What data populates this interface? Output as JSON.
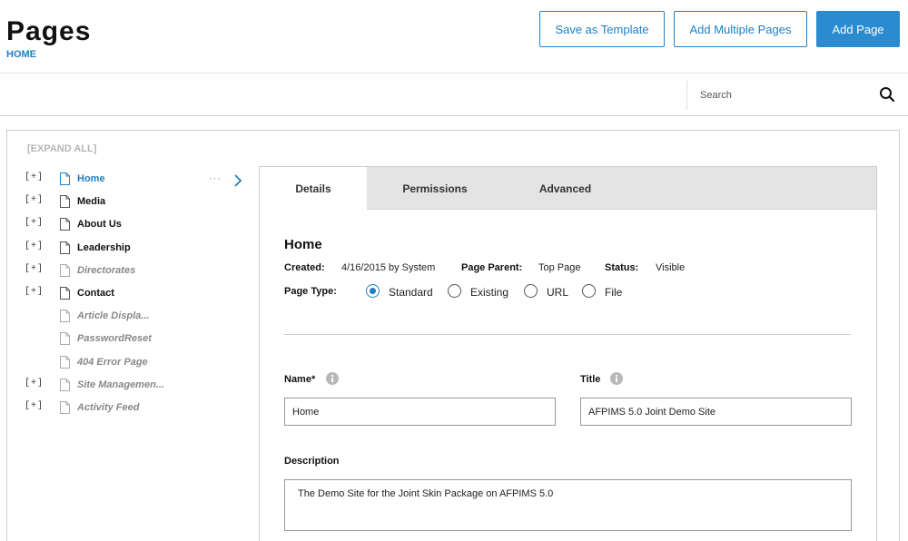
{
  "header": {
    "title": "Pages",
    "breadcrumb": "HOME",
    "buttons": {
      "save_template": "Save as Template",
      "add_multiple": "Add Multiple Pages",
      "add_page": "Add Page"
    }
  },
  "search": {
    "placeholder": "Search",
    "icon": "search-icon"
  },
  "tree": {
    "expand_all": "[EXPAND ALL]",
    "items": [
      {
        "label": "Home",
        "toggle": "[+]",
        "style": "active"
      },
      {
        "label": "Media",
        "toggle": "[+]",
        "style": "normal"
      },
      {
        "label": "About Us",
        "toggle": "[+]",
        "style": "normal"
      },
      {
        "label": "Leadership",
        "toggle": "[+]",
        "style": "normal"
      },
      {
        "label": "Directorates",
        "toggle": "[+]",
        "style": "italic"
      },
      {
        "label": "Contact",
        "toggle": "[+]",
        "style": "normal"
      },
      {
        "label": "Article Displa...",
        "toggle": "",
        "style": "italic"
      },
      {
        "label": "PasswordReset",
        "toggle": "",
        "style": "italic"
      },
      {
        "label": "404 Error Page",
        "toggle": "",
        "style": "italic"
      },
      {
        "label": "Site Managemen...",
        "toggle": "[+]",
        "style": "italic"
      },
      {
        "label": "Activity Feed",
        "toggle": "[+]",
        "style": "italic"
      }
    ],
    "active_dots": "···"
  },
  "tabs": [
    "Details",
    "Permissions",
    "Advanced"
  ],
  "details": {
    "title": "Home",
    "created_label": "Created:",
    "created_value": "4/16/2015 by System",
    "parent_label": "Page Parent:",
    "parent_value": "Top Page",
    "status_label": "Status:",
    "status_value": "Visible",
    "page_type_label": "Page Type:",
    "page_types": [
      "Standard",
      "Existing",
      "URL",
      "File"
    ],
    "selected_page_type": "Standard",
    "name_label": "Name*",
    "name_value": "Home",
    "title_label": "Title",
    "title_value": "AFPIMS 5.0 Joint Demo Site",
    "description_label": "Description",
    "description_value": "The Demo Site for the Joint Skin Package on AFPIMS 5.0"
  },
  "colors": {
    "accent": "#1f7fc4",
    "primary_button": "#2a8bd0",
    "tab_bar": "#e4e4e4"
  }
}
